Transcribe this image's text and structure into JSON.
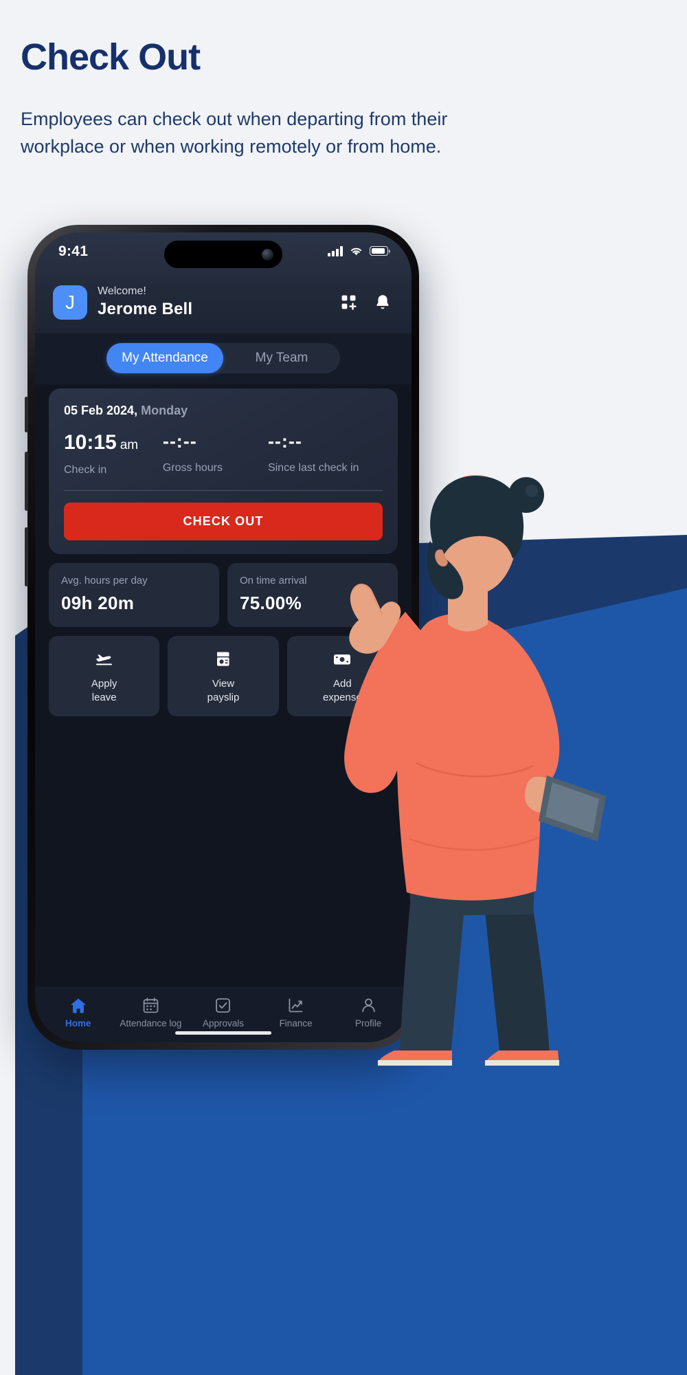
{
  "promo": {
    "title": "Check Out",
    "description": "Employees can check out when departing from their workplace or when working remotely or from home."
  },
  "colors": {
    "page_background": "#f1f3f6",
    "promo_text": "#16306b",
    "backdrop_blue": "#1f57a8",
    "accent_blue": "#4285f4",
    "checkout_red": "#d8291c",
    "card_dark": "#232b3b",
    "screen_dark": "#10151f"
  },
  "status_bar": {
    "time": "9:41",
    "signal_icon": "cellular-bars-icon",
    "wifi_icon": "wifi-icon",
    "battery_icon": "battery-icon"
  },
  "header": {
    "avatar_initial": "J",
    "greeting": "Welcome!",
    "user_name": "Jerome Bell",
    "apps_icon": "apps-grid-add-icon",
    "bell_icon": "notification-bell-icon"
  },
  "tabs": [
    {
      "label": "My Attendance",
      "active": true
    },
    {
      "label": "My Team",
      "active": false
    }
  ],
  "attendance_card": {
    "date": "05 Feb 2024,",
    "day": "Monday",
    "metrics": [
      {
        "value": "10:15",
        "suffix": "am",
        "label": "Check in"
      },
      {
        "value": "--:--",
        "suffix": "",
        "label": "Gross hours"
      },
      {
        "value": "--:--",
        "suffix": "",
        "label": "Since last check in"
      }
    ],
    "action_button": "CHECK OUT"
  },
  "stats": [
    {
      "label": "Avg. hours per day",
      "value": "09h 20m"
    },
    {
      "label": "On time arrival",
      "value": "75.00%"
    }
  ],
  "quick_actions": [
    {
      "icon": "airplane-leave-icon",
      "line1": "Apply",
      "line2": "leave"
    },
    {
      "icon": "payslip-document-icon",
      "line1": "View",
      "line2": "payslip"
    },
    {
      "icon": "money-expense-icon",
      "line1": "Add",
      "line2": "expense"
    }
  ],
  "bottom_nav": [
    {
      "icon": "home-icon",
      "label": "Home",
      "active": true
    },
    {
      "icon": "calendar-icon",
      "label": "Attendance log",
      "active": false
    },
    {
      "icon": "check-square-icon",
      "label": "Approvals",
      "active": false
    },
    {
      "icon": "chart-trend-icon",
      "label": "Finance",
      "active": false
    },
    {
      "icon": "person-icon",
      "label": "Profile",
      "active": false
    }
  ]
}
